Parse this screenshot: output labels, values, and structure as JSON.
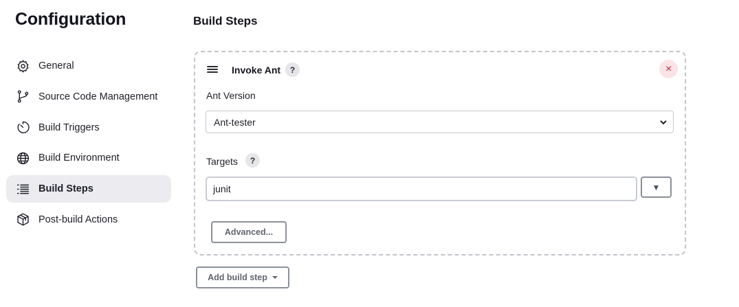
{
  "sidebar": {
    "title": "Configuration",
    "items": [
      {
        "label": "General",
        "icon": "gear-icon",
        "active": false
      },
      {
        "label": "Source Code Management",
        "icon": "git-branch-icon",
        "active": false
      },
      {
        "label": "Build Triggers",
        "icon": "clock-icon",
        "active": false
      },
      {
        "label": "Build Environment",
        "icon": "globe-icon",
        "active": false
      },
      {
        "label": "Build Steps",
        "icon": "list-icon",
        "active": true
      },
      {
        "label": "Post-build Actions",
        "icon": "package-icon",
        "active": false
      }
    ]
  },
  "main": {
    "section_title": "Build Steps",
    "step": {
      "title": "Invoke Ant",
      "help_label": "?",
      "close_label": "×",
      "ant_version_label": "Ant Version",
      "ant_version_value": "Ant-tester",
      "targets_label": "Targets",
      "targets_help_label": "?",
      "targets_value": "junit",
      "expand_label": "▼",
      "advanced_label": "Advanced..."
    },
    "add_build_step_label": "Add build step"
  },
  "colors": {
    "active_bg": "#ebebf0",
    "close_bg": "#fbe4e6",
    "close_fg": "#d0263c",
    "dashed_border": "#c4c4cc"
  }
}
